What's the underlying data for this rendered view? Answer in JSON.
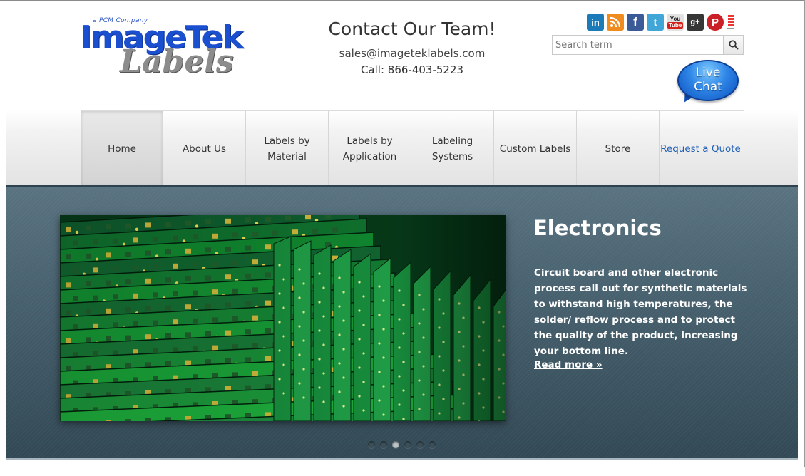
{
  "logo": {
    "tagline": "a PCM Company",
    "line1": "ImageTek",
    "line2": "Labels"
  },
  "contact": {
    "title": "Contact Our Team!",
    "email": "sales@imageteklabels.com",
    "phone": "Call: 866-403-5223"
  },
  "social": [
    {
      "name": "linkedin-icon",
      "glyph": "in"
    },
    {
      "name": "rss-icon",
      "glyph": ""
    },
    {
      "name": "facebook-icon",
      "glyph": "f"
    },
    {
      "name": "twitter-icon",
      "glyph": "t"
    },
    {
      "name": "youtube-icon",
      "glyph": "You"
    },
    {
      "name": "google-plus-icon",
      "glyph": "g+"
    },
    {
      "name": "pinterest-icon",
      "glyph": "P"
    }
  ],
  "search": {
    "placeholder": "Search term"
  },
  "livechat": {
    "line1": "Live",
    "line2": "Chat"
  },
  "nav": {
    "items": [
      {
        "label": "Home"
      },
      {
        "label": "About Us"
      },
      {
        "label": "Labels by\nMaterial"
      },
      {
        "label": "Labels by\nApplication"
      },
      {
        "label": "Labeling\nSystems"
      },
      {
        "label": "Custom Labels"
      },
      {
        "label": "Store"
      },
      {
        "label": "Request a Quote"
      }
    ],
    "active_index": 0
  },
  "slider": {
    "title": "Electronics",
    "body": "Circuit board and other electronic process call out for synthetic materials to withstand high temperatures, the solder/ reflow process and to protect the quality of the product, increasing your bottom line.",
    "read_more": "Read more »",
    "slide_count": 6,
    "active_slide": 3
  },
  "colors": {
    "brand_blue": "#1a4fd0",
    "slider_bg": "#4a6371",
    "quote_link": "#1f5fb6"
  }
}
